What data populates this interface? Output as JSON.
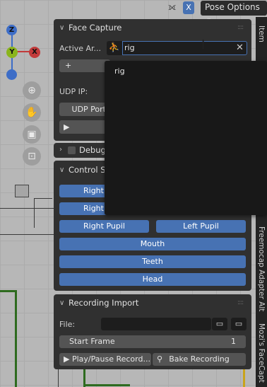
{
  "header": {
    "pose_options": "Pose Options",
    "x_label": "X"
  },
  "gizmo": {
    "z": "Z",
    "y": "Y",
    "x": "X"
  },
  "face_capture": {
    "title": "Face Capture",
    "active_armature_label": "Active Ar...",
    "active_armature_value": "rig",
    "udp_ip_label": "UDP IP:",
    "udp_port_label": "UDP Port",
    "add_symbol": "+"
  },
  "dropdown": {
    "items": [
      "rig"
    ]
  },
  "debug": {
    "title": "Debug"
  },
  "control_selection": {
    "title": "Control Se",
    "right_1": "Right",
    "right_2": "Right",
    "right_pupil": "Right Pupil",
    "left_pupil": "Left Pupil",
    "mouth": "Mouth",
    "teeth": "Teeth",
    "head": "Head"
  },
  "recording_import": {
    "title": "Recording Import",
    "file_label": "File:",
    "file_value": "",
    "start_frame_label": "Start Frame",
    "start_frame_value": "1",
    "play_pause_label": "Play/Pause Record...",
    "bake_label": "Bake Recording"
  },
  "sidebar_tabs": [
    "Item",
    "Freemocap Adapter Alt",
    "Mozi's FaceCapt"
  ]
}
